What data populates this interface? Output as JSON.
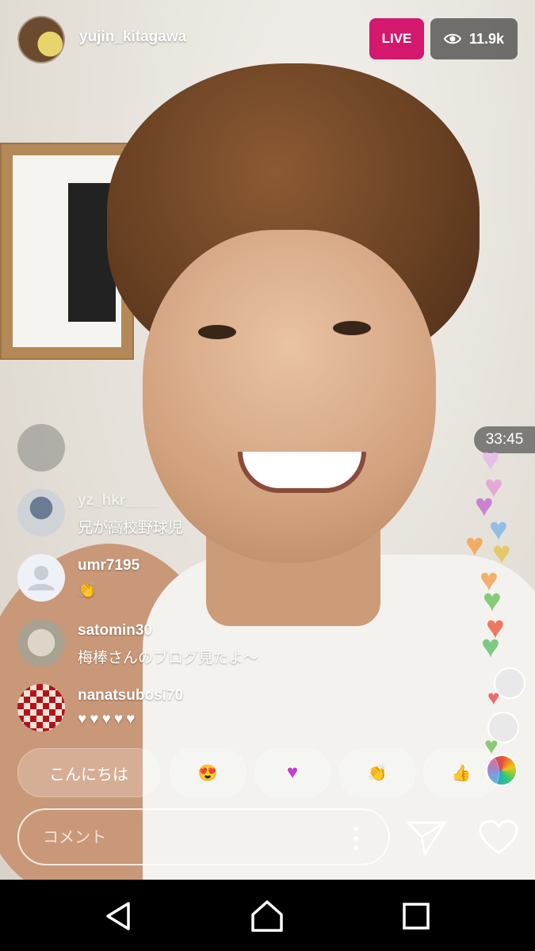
{
  "stream": {
    "host_username": "yujin_kitagawa",
    "live_label": "LIVE",
    "viewer_count": "11.9k",
    "elapsed_time": "33:45"
  },
  "comments": [
    {
      "username": "",
      "text": ""
    },
    {
      "username": "yz_hkr____",
      "text": "兄が高校野球児"
    },
    {
      "username": "umr7195",
      "text": "👏"
    },
    {
      "username": "satomin30",
      "text": "梅棒さんのブログ見たよ～"
    },
    {
      "username": "nanatsubosi70",
      "text": "♥♥♥♥♥"
    }
  ],
  "quick_reactions": [
    {
      "label": "こんにちは"
    },
    {
      "label": "😍"
    },
    {
      "label": "♥"
    },
    {
      "label": "👏"
    },
    {
      "label": "👍"
    }
  ],
  "comment_input": {
    "placeholder": "コメント",
    "value": ""
  },
  "colors": {
    "live": "#d3186e",
    "viewer_pill": "#464646",
    "heart_red": "#e0101c"
  },
  "icons": {
    "viewers": "eye-icon",
    "options": "more-vertical-icon",
    "send": "paper-plane-icon",
    "like": "heart-outline-icon",
    "nav_back": "triangle-back-icon",
    "nav_home": "circle-home-icon",
    "nav_recents": "square-recents-icon"
  }
}
